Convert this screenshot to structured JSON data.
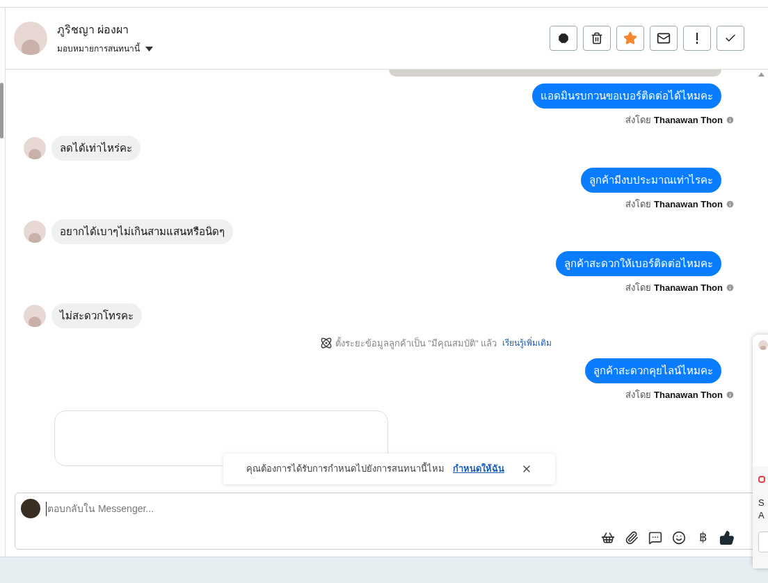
{
  "contact": {
    "name": "ภูริชญา ผ่องผา",
    "assign_label": "มอบหมายการสนทนานี้",
    "starred": true
  },
  "toolbar": [
    {
      "kind": "alert"
    },
    {
      "kind": "trash"
    },
    {
      "kind": "star"
    },
    {
      "kind": "mail"
    },
    {
      "kind": "exclaim"
    },
    {
      "kind": "check"
    }
  ],
  "messages": [
    {
      "kind": "image"
    },
    {
      "kind": "outgoing",
      "text": "แอดมินรบกวนขอเบอร์ติดต่อได้ไหมคะ",
      "sent_by_label": "ส่งโดย",
      "sender": "Thanawan Thon"
    },
    {
      "kind": "incoming",
      "text": "ลดได้เท่าไหร่คะ"
    },
    {
      "kind": "outgoing",
      "text": "ลูกค้ามีงบประมาณเท่าไรคะ",
      "sent_by_label": "ส่งโดย",
      "sender": "Thanawan Thon"
    },
    {
      "kind": "incoming",
      "text": "อยากได้เบาๆไม่เกินสามแสนหรือนิดๆ"
    },
    {
      "kind": "outgoing",
      "text": "ลูกค้าสะดวกให้เบอร์ติดต่อไหมคะ",
      "sent_by_label": "ส่งโดย",
      "sender": "Thanawan Thon"
    },
    {
      "kind": "incoming",
      "text": "ไม่สะดวกโทรคะ"
    },
    {
      "kind": "system",
      "text": "ตั้งระยะข้อมูลลูกค้าเป็น \"มีคุณสมบัติ\" แล้ว",
      "link": "เรียนรู้เพิ่มเติม"
    },
    {
      "kind": "outgoing",
      "text": "ลูกค้าสะดวกคุยไลน์ไหมคะ",
      "sent_by_label": "ส่งโดย",
      "sender": "Thanawan Thon"
    },
    {
      "kind": "card"
    }
  ],
  "toast": {
    "text": "คุณต้องการได้รับการกำหนดไปยังการสนทนานี้ไหม",
    "link": "กำหนดให้ฉัน"
  },
  "composer": {
    "placeholder": "ตอบกลับใน Messenger...",
    "currency_symbol": "฿"
  },
  "side_popup": {
    "lines": [
      "S",
      "A"
    ]
  }
}
